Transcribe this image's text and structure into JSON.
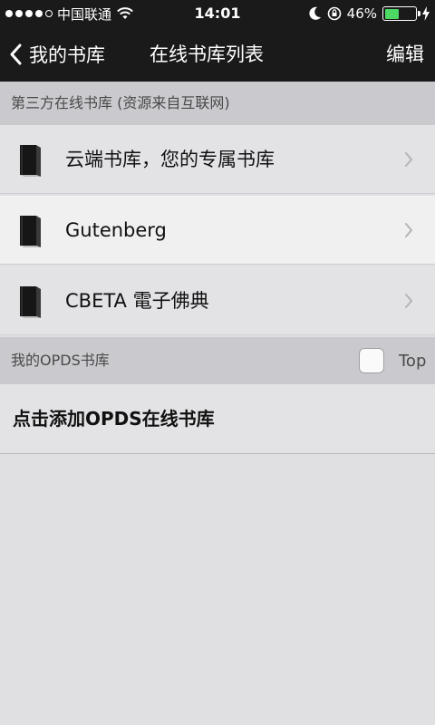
{
  "status_bar": {
    "carrier": "中国联通",
    "time": "14:01",
    "battery_percent": "46%",
    "battery_level": 0.46,
    "signal_bars_filled": 4,
    "signal_bars_total": 5
  },
  "nav": {
    "back_label": "我的书库",
    "title": "在线书库列表",
    "edit_label": "编辑"
  },
  "sections": {
    "third_party_header": "第三方在线书库 (资源来自互联网)",
    "opds_header": "我的OPDS书库",
    "opds_toggle_label": "Top"
  },
  "libraries": [
    {
      "label": "云端书库，您的专属书库",
      "icon": "book-icon"
    },
    {
      "label": "Gutenberg",
      "icon": "book-icon"
    },
    {
      "label": "CBETA 電子佛典",
      "icon": "book-icon"
    }
  ],
  "add_opds_label": "点击添加OPDS在线书库",
  "colors": {
    "bar_bg": "#1a1a1a",
    "section_bg": "#c9c9ce",
    "row_bg": "#e3e3e6",
    "battery_green": "#4cd964"
  }
}
